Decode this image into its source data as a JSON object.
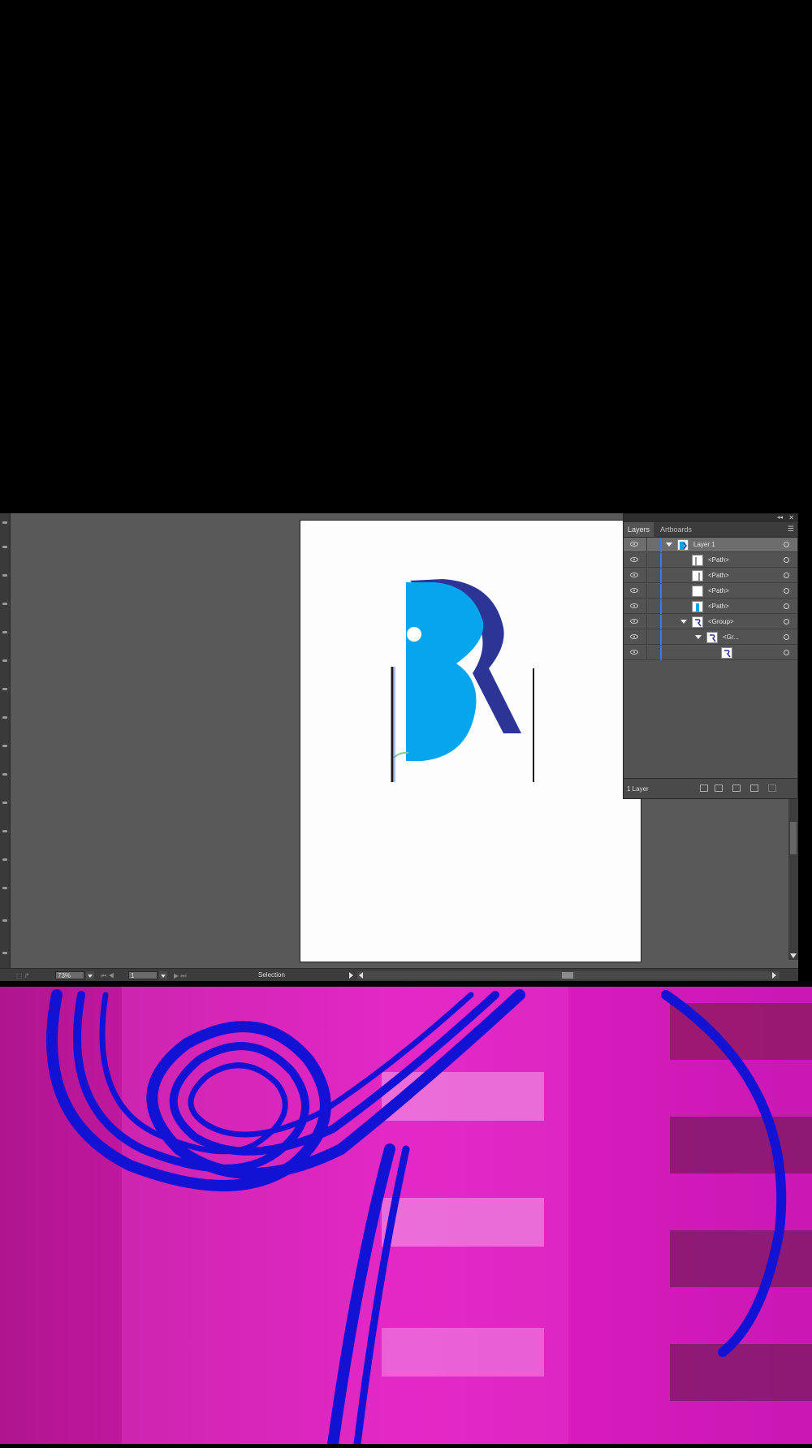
{
  "app": {
    "zoom": "73%",
    "artboard_number": "1",
    "status_tool": "Selection"
  },
  "layers_panel": {
    "tabs": [
      {
        "label": "Layers"
      },
      {
        "label": "Artboards"
      }
    ],
    "collapse_glyph": "◂◂",
    "close_glyph": "✕",
    "menu_glyph": "☰",
    "rows": [
      {
        "name": "Layer 1"
      },
      {
        "name": "<Path>"
      },
      {
        "name": "<Path>"
      },
      {
        "name": "<Path>"
      },
      {
        "name": "<Path>"
      },
      {
        "name": "<Group>"
      },
      {
        "name": "<Gr..."
      },
      {
        "name": ""
      }
    ],
    "footer_count": "1 Layer"
  },
  "artwork": {
    "letter_color_light": "#06a6ef",
    "letter_color_dark": "#2c3596",
    "guide_color": "#1a1a1a",
    "background_magenta": "#d81bb8",
    "stroke_blue": "#1212d4"
  }
}
